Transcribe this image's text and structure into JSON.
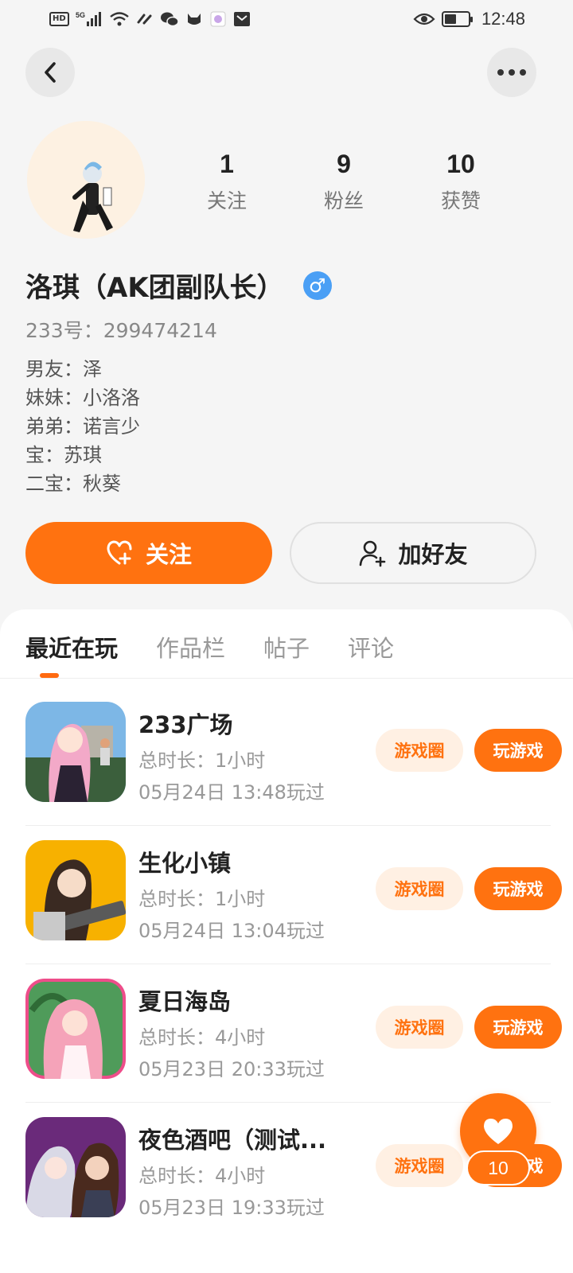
{
  "status_bar": {
    "network_badge": "HD",
    "signal_label": "5G",
    "time": "12:48",
    "battery_level": 0.5
  },
  "profile": {
    "stats": [
      {
        "value": "1",
        "label": "关注"
      },
      {
        "value": "9",
        "label": "粉丝"
      },
      {
        "value": "10",
        "label": "获赞"
      }
    ],
    "name": "洛琪（AK团副队长）",
    "gender_symbol": "♂",
    "uid": "233号：299474214",
    "bio": [
      "男友：泽",
      "妹妹：小洛洛",
      "弟弟：诺言少",
      "宝：苏琪",
      "二宝：秋葵"
    ],
    "follow_label": "关注",
    "add_friend_label": "加好友"
  },
  "tabs": [
    "最近在玩",
    "作品栏",
    "帖子",
    "评论"
  ],
  "games": [
    {
      "title": "233广场",
      "duration": "总时长：1小时",
      "last_played": "05月24日 13:48玩过",
      "circle_label": "游戏圈",
      "play_label": "玩游戏"
    },
    {
      "title": "生化小镇",
      "duration": "总时长：1小时",
      "last_played": "05月24日 13:04玩过",
      "circle_label": "游戏圈",
      "play_label": "玩游戏"
    },
    {
      "title": "夏日海岛",
      "duration": "总时长：4小时",
      "last_played": "05月23日 20:33玩过",
      "circle_label": "游戏圈",
      "play_label": "玩游戏"
    },
    {
      "title": "夜色酒吧（测试...",
      "duration": "总时长：4小时",
      "last_played": "05月23日 19:33玩过",
      "circle_label": "游戏圈",
      "play_label": "玩游戏"
    }
  ],
  "like_fab": {
    "count": "10"
  },
  "colors": {
    "accent": "#ff7210",
    "accent_soft": "#fff0e3",
    "gender_blue": "#4a9ff5"
  }
}
